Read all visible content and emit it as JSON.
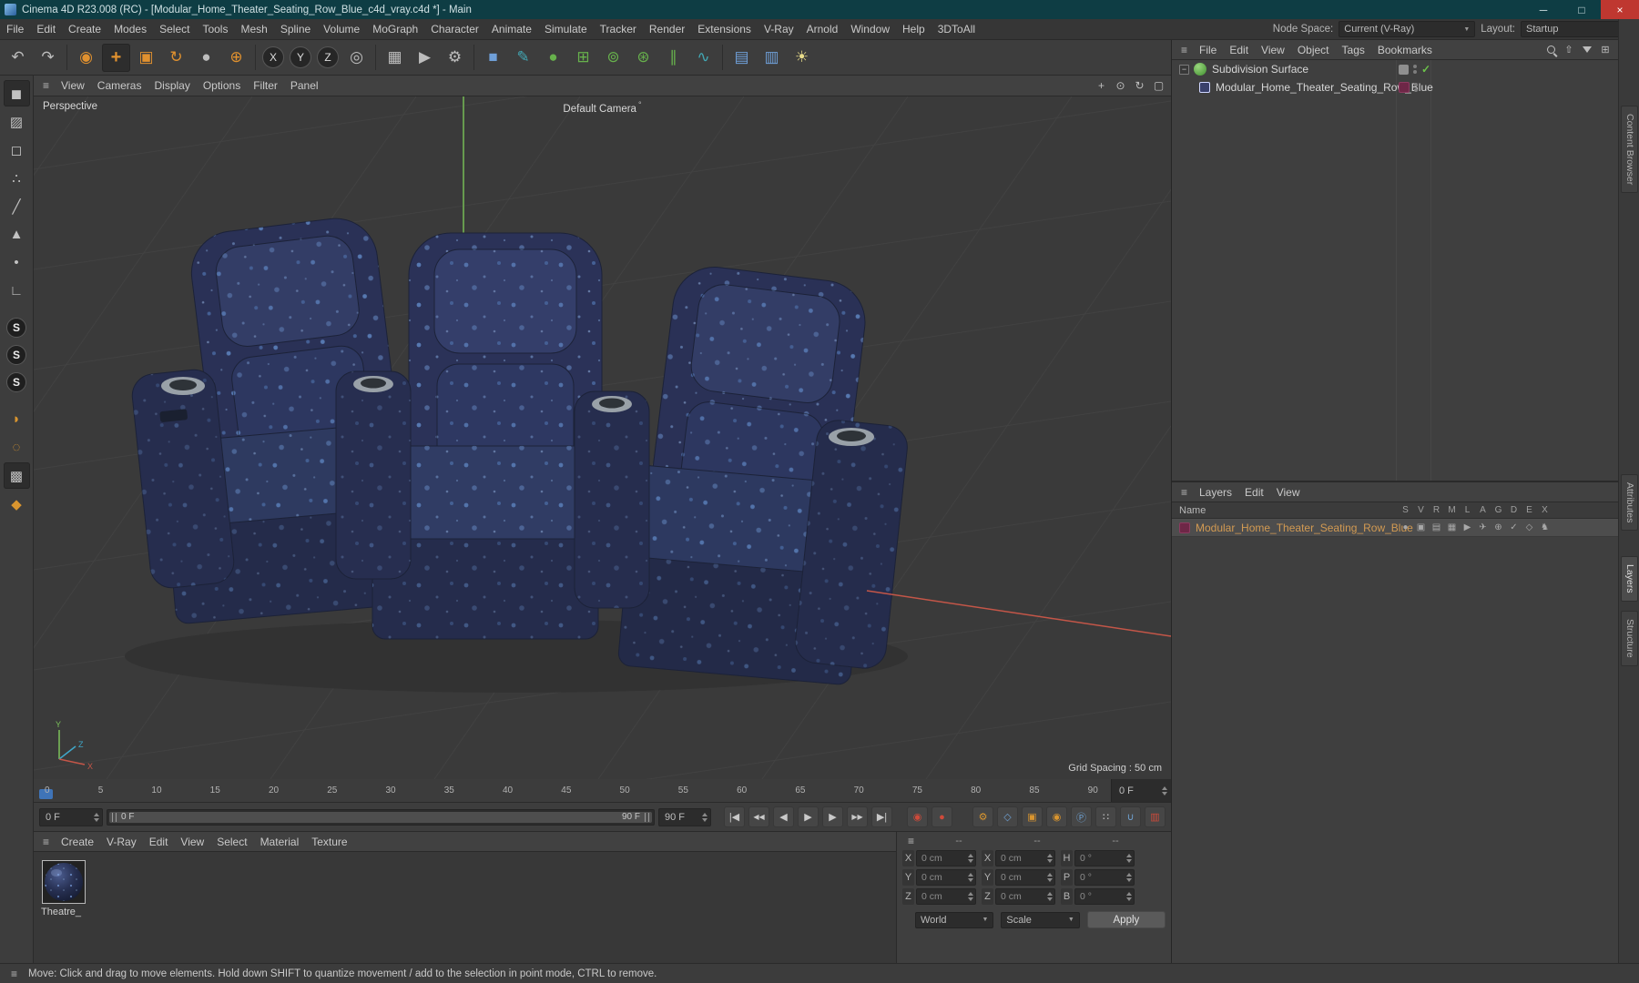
{
  "titlebar": {
    "title": "Cinema 4D R23.008 (RC) - [Modular_Home_Theater_Seating_Row_Blue_c4d_vray.c4d *] - Main"
  },
  "menubar": {
    "items": [
      "File",
      "Edit",
      "Create",
      "Modes",
      "Select",
      "Tools",
      "Mesh",
      "Spline",
      "Volume",
      "MoGraph",
      "Character",
      "Animate",
      "Simulate",
      "Tracker",
      "Render",
      "Extensions",
      "V-Ray",
      "Arnold",
      "Window",
      "Help",
      "3DToAll"
    ],
    "node_space_label": "Node Space:",
    "node_space_value": "Current (V-Ray)",
    "layout_label": "Layout:",
    "layout_value": "Startup"
  },
  "viewport": {
    "menu": [
      "View",
      "Cameras",
      "Display",
      "Options",
      "Filter",
      "Panel"
    ],
    "view_label": "Perspective",
    "camera_label": "Default Camera",
    "grid_spacing": "Grid Spacing : 50 cm",
    "axis": {
      "x": "X",
      "y": "Y",
      "z": "Z"
    }
  },
  "timeline": {
    "ticks": [
      "0",
      "5",
      "10",
      "15",
      "20",
      "25",
      "30",
      "35",
      "40",
      "45",
      "50",
      "55",
      "60",
      "65",
      "70",
      "75",
      "80",
      "85",
      "90"
    ],
    "ruler_frame": "0 F",
    "current": "0 F",
    "range_start": "0 F",
    "range_end": "90 F",
    "end": "90 F"
  },
  "materials": {
    "menu": [
      "Create",
      "V-Ray",
      "Edit",
      "View",
      "Select",
      "Material",
      "Texture"
    ],
    "items": [
      {
        "name": "Theatre_"
      }
    ]
  },
  "coords": {
    "headers": [
      "--",
      "--",
      "--"
    ],
    "rows": [
      {
        "p": "X",
        "pv": "0 cm",
        "s": "X",
        "sv": "0 cm",
        "r": "H",
        "rv": "0 °"
      },
      {
        "p": "Y",
        "pv": "0 cm",
        "s": "Y",
        "sv": "0 cm",
        "r": "P",
        "rv": "0 °"
      },
      {
        "p": "Z",
        "pv": "0 cm",
        "s": "Z",
        "sv": "0 cm",
        "r": "B",
        "rv": "0 °"
      }
    ],
    "world": "World",
    "scale": "Scale",
    "apply": "Apply"
  },
  "om": {
    "menu": [
      "File",
      "Edit",
      "View",
      "Object",
      "Tags",
      "Bookmarks"
    ],
    "objects": [
      {
        "name": "Subdivision Surface"
      },
      {
        "name": "Modular_Home_Theater_Seating_Row_Blue"
      }
    ]
  },
  "layers": {
    "menu": [
      "Layers",
      "Edit",
      "View"
    ],
    "name_header": "Name",
    "columns": [
      "S",
      "V",
      "R",
      "M",
      "L",
      "A",
      "G",
      "D",
      "E",
      "X"
    ],
    "row_name": "Modular_Home_Theater_Seating_Row_Blue",
    "toggles": [
      "●",
      "▣",
      "▤",
      "▦",
      "▶",
      "✈",
      "⊕",
      "✓",
      "◇",
      "♞"
    ]
  },
  "right_tabs": [
    "Content Browser",
    "Attributes",
    "Layers",
    "Structure"
  ],
  "statusbar": {
    "text": "Move: Click and drag to move elements. Hold down SHIFT to quantize movement / add to the selection in point mode, CTRL to remove."
  },
  "colors": {
    "titlebar_teal": "#0e3d44",
    "accent_orange": "#e0912f",
    "seat_navy": "#2b3258",
    "speckle_blue": "#6fa0e2",
    "axis_green": "#74b954",
    "axis_red": "#c45648",
    "layer_tag_maroon": "#6e2747",
    "layer_name_text": "#d29a52"
  },
  "icons": {
    "hamburger": "≡",
    "win_min": "─",
    "win_max": "□",
    "win_close": "×",
    "dd": "▼",
    "collapse": "−",
    "check": "✓",
    "undo": "↶",
    "redo": "↷",
    "live_selection": "◉",
    "move": "+",
    "scale": "▣",
    "rotate": "↻",
    "last_tool": "●",
    "axis": "⊕",
    "lock_x": "X",
    "lock_y": "Y",
    "lock_z": "Z",
    "coord_sys": "◎",
    "render_view": "▦",
    "render_pv": "▶",
    "render_settings": "⚙",
    "add_cube": "■",
    "pen": "✎",
    "sds": "●",
    "generators": "⊞",
    "boole": "⊚",
    "tracer": "⊛",
    "symmetry": "∥",
    "deformer": "∿",
    "floor": "▤",
    "stage": "▥",
    "light": "☀",
    "model_mode": "◼",
    "texture_mode": "▨",
    "object_mode": "◻",
    "points_mode": "∴",
    "edges_mode": "╱",
    "polygons_mode": "▲",
    "tweak_mode": "•",
    "workplane": "∟",
    "snap": "S",
    "paint": "◗",
    "sel_mask": "◌",
    "tex_view": "▩",
    "uv": "◆",
    "pan": "+",
    "zoom": "⊙",
    "orbit": "↻",
    "maximize": "▢",
    "goto_start": "|◀",
    "prev_key": "◀◀",
    "prev_frame": "◀",
    "play": "▶",
    "next_frame": "▶",
    "next_key": "▶▶",
    "goto_end": "▶|",
    "record": "◉",
    "autokey": "●",
    "key_gear": "⚙",
    "key_filter": "◇",
    "key_pos": "▣",
    "key_rot": "◉",
    "key_param": "Ⓟ",
    "key_pla": "∷",
    "magnet": "∪",
    "rec_obj": "▥",
    "om_up": "⇧",
    "om_grid": "⊞",
    "cam_marker": "°"
  }
}
